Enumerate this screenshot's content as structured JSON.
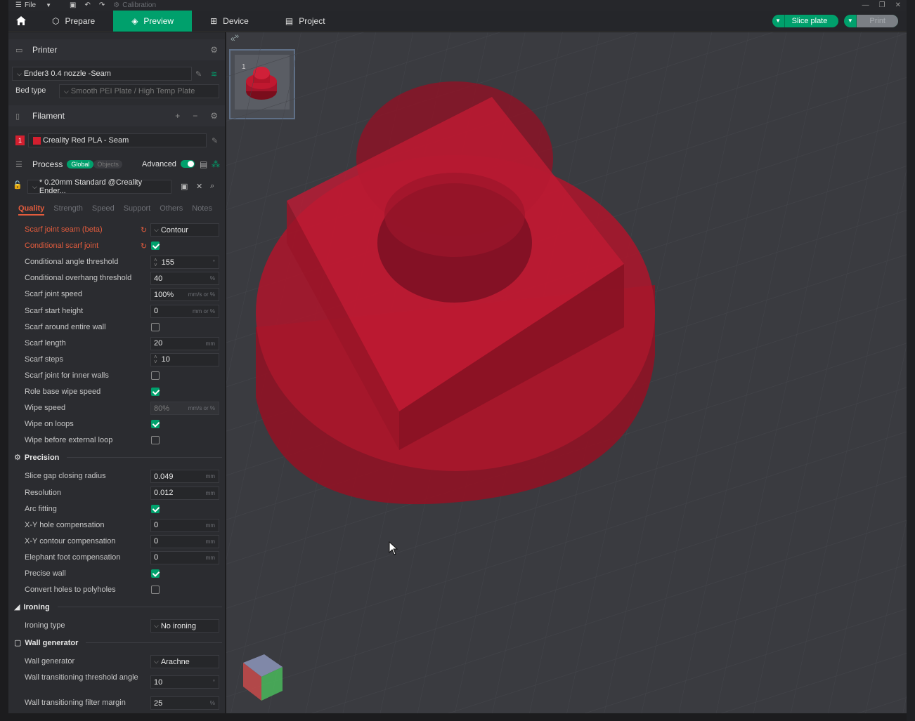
{
  "titlebar": {
    "file": "File",
    "calibration": "Calibration"
  },
  "topbar": {
    "tabs": [
      {
        "label": "Prepare",
        "active": false
      },
      {
        "label": "Preview",
        "active": true
      },
      {
        "label": "Device",
        "active": false
      },
      {
        "label": "Project",
        "active": false
      }
    ],
    "slice_label": "Slice plate",
    "print_label": "Print"
  },
  "printer": {
    "header": "Printer",
    "name": "Ender3 0.4 nozzle -Seam",
    "bed_type_label": "Bed type",
    "bed_type_value": "Smooth PEI Plate / High Temp Plate"
  },
  "filament": {
    "header": "Filament",
    "index": "1",
    "name": "Creality Red PLA - Seam",
    "color": "#d31f2f"
  },
  "process": {
    "header": "Process",
    "global": "Global",
    "objects": "Objects",
    "advanced": "Advanced",
    "preset": "* 0.20mm Standard @Creality Ender..."
  },
  "subtabs": [
    "Quality",
    "Strength",
    "Speed",
    "Support",
    "Others",
    "Notes"
  ],
  "quality_rows": [
    {
      "label": "Scarf joint seam (beta)",
      "type": "select",
      "value": "Contour",
      "modified": true
    },
    {
      "label": "Conditional scarf joint",
      "type": "check",
      "checked": true,
      "modified": true
    },
    {
      "label": "Conditional angle threshold",
      "type": "spin",
      "value": "155",
      "unit": "°"
    },
    {
      "label": "Conditional overhang threshold",
      "type": "input",
      "value": "40",
      "unit": "%"
    },
    {
      "label": "Scarf joint speed",
      "type": "input",
      "value": "100%",
      "unit": "mm/s or %"
    },
    {
      "label": "Scarf start height",
      "type": "input",
      "value": "0",
      "unit": "mm or %"
    },
    {
      "label": "Scarf around entire wall",
      "type": "check",
      "checked": false
    },
    {
      "label": "Scarf length",
      "type": "input",
      "value": "20",
      "unit": "mm"
    },
    {
      "label": "Scarf steps",
      "type": "spin",
      "value": "10",
      "unit": ""
    },
    {
      "label": "Scarf joint for inner walls",
      "type": "check",
      "checked": false
    },
    {
      "label": "Role base wipe speed",
      "type": "check",
      "checked": true
    },
    {
      "label": "Wipe speed",
      "type": "input",
      "value": "80%",
      "unit": "mm/s or %",
      "disabled": true
    },
    {
      "label": "Wipe on loops",
      "type": "check",
      "checked": true
    },
    {
      "label": "Wipe before external loop",
      "type": "check",
      "checked": false
    }
  ],
  "precision": {
    "header": "Precision",
    "rows": [
      {
        "label": "Slice gap closing radius",
        "type": "input",
        "value": "0.049",
        "unit": "mm"
      },
      {
        "label": "Resolution",
        "type": "input",
        "value": "0.012",
        "unit": "mm"
      },
      {
        "label": "Arc fitting",
        "type": "check",
        "checked": true
      },
      {
        "label": "X-Y hole compensation",
        "type": "input",
        "value": "0",
        "unit": "mm"
      },
      {
        "label": "X-Y contour compensation",
        "type": "input",
        "value": "0",
        "unit": "mm"
      },
      {
        "label": "Elephant foot compensation",
        "type": "input",
        "value": "0",
        "unit": "mm"
      },
      {
        "label": "Precise wall",
        "type": "check",
        "checked": true
      },
      {
        "label": "Convert holes to polyholes",
        "type": "check",
        "checked": false
      }
    ]
  },
  "ironing": {
    "header": "Ironing",
    "rows": [
      {
        "label": "Ironing type",
        "type": "select",
        "value": "No ironing"
      }
    ]
  },
  "wall_generator": {
    "header": "Wall generator",
    "rows": [
      {
        "label": "Wall generator",
        "type": "select",
        "value": "Arachne"
      },
      {
        "label": "Wall transitioning threshold angle",
        "type": "input",
        "value": "10",
        "unit": "°",
        "tall": true
      },
      {
        "label": "Wall transitioning filter margin",
        "type": "input",
        "value": "25",
        "unit": "%"
      }
    ]
  },
  "viewport": {
    "plate_number": "1",
    "accent": "#00a06c",
    "model_color": "#b3142b"
  }
}
